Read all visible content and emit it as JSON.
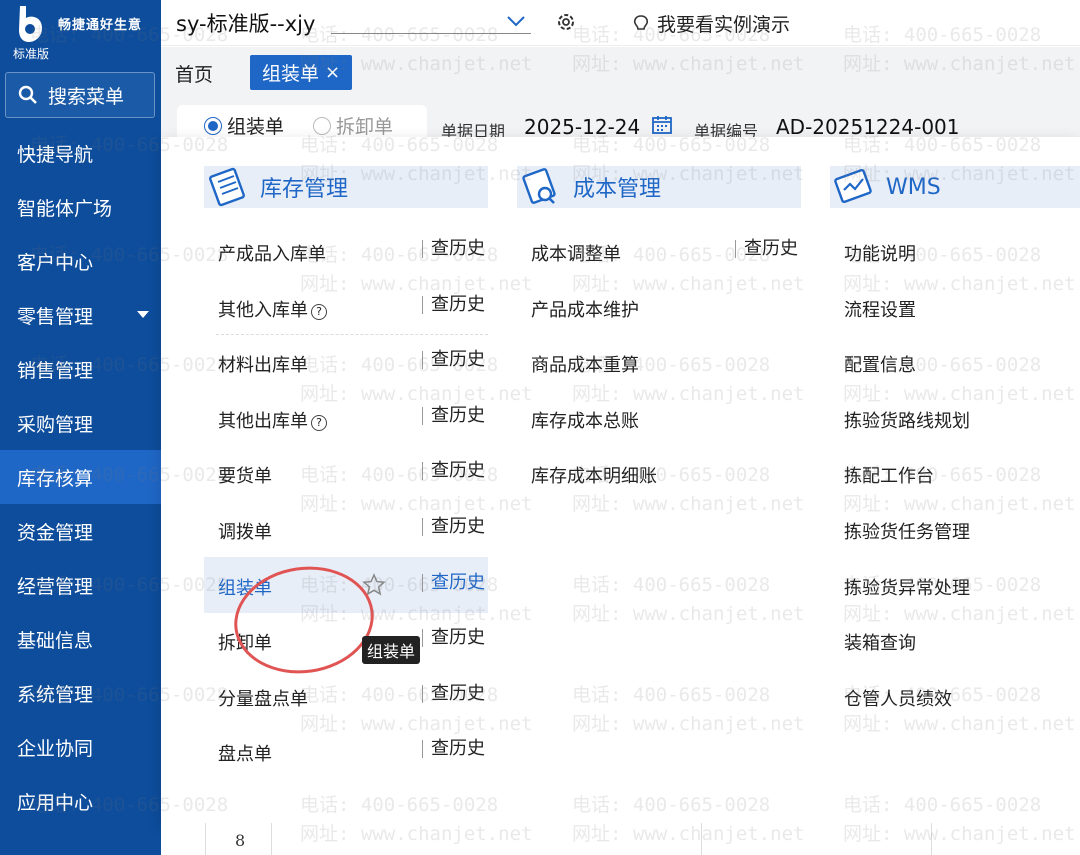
{
  "brand": {
    "name": "畅捷通好生意",
    "edition": "标准版"
  },
  "sidebar": {
    "search_label": "搜索菜单",
    "items": [
      {
        "label": "快捷导航"
      },
      {
        "label": "智能体广场"
      },
      {
        "label": "客户中心"
      },
      {
        "label": "零售管理"
      },
      {
        "label": "销售管理"
      },
      {
        "label": "采购管理"
      },
      {
        "label": "库存核算"
      },
      {
        "label": "资金管理"
      },
      {
        "label": "经营管理"
      },
      {
        "label": "基础信息"
      },
      {
        "label": "系统管理"
      },
      {
        "label": "企业协同"
      },
      {
        "label": "应用中心"
      }
    ],
    "active_index": 6
  },
  "topbar": {
    "account": "sy-标准版--xjy",
    "demo_label": "我要看实例演示"
  },
  "tabs": {
    "home": "首页",
    "active": "组装单",
    "close": "×"
  },
  "form": {
    "radio_assemble": "组装单",
    "radio_disassemble": "拆卸单",
    "date_label": "单据日期",
    "date_value": "2025-12-24",
    "number_label": "单据编号",
    "number_value": "AD-20251224-001"
  },
  "menu": {
    "history_label": "查历史",
    "columns": [
      {
        "title": "库存管理",
        "items": [
          {
            "label": "产成品入库单",
            "help": false,
            "history": true
          },
          {
            "label": "其他入库单",
            "help": true,
            "history": true
          },
          {
            "label": "材料出库单",
            "help": false,
            "history": true
          },
          {
            "label": "其他出库单",
            "help": true,
            "history": true
          },
          {
            "label": "要货单",
            "help": false,
            "history": true
          },
          {
            "label": "调拨单",
            "help": false,
            "history": true
          },
          {
            "label": "组装单",
            "help": false,
            "history": true
          },
          {
            "label": "拆卸单",
            "help": false,
            "history": true
          },
          {
            "label": "分量盘点单",
            "help": false,
            "history": true
          },
          {
            "label": "盘点单",
            "help": false,
            "history": true
          }
        ]
      },
      {
        "title": "成本管理",
        "items": [
          {
            "label": "成本调整单",
            "history": true
          },
          {
            "label": "产品成本维护",
            "history": false
          },
          {
            "label": "商品成本重算",
            "history": false
          },
          {
            "label": "库存成本总账",
            "history": false
          },
          {
            "label": "库存成本明细账",
            "history": false
          }
        ]
      },
      {
        "title": "WMS",
        "items": [
          {
            "label": "功能说明"
          },
          {
            "label": "流程设置"
          },
          {
            "label": "配置信息"
          },
          {
            "label": "拣验货路线规划"
          },
          {
            "label": "拣配工作台"
          },
          {
            "label": "拣验货任务管理"
          },
          {
            "label": "拣验货异常处理"
          },
          {
            "label": "装箱查询"
          },
          {
            "label": "仓管人员绩效"
          }
        ]
      }
    ],
    "tooltip": "组装单",
    "highlighted": "组装单"
  },
  "watermark": {
    "phone": "电话: 400-665-0028",
    "site": "网址: www.chanjet.net"
  },
  "table_peek": {
    "row_number": "8"
  },
  "colors": {
    "sidebar": "#0d4d9c",
    "accent": "#1f67c6",
    "annotation": "#e05454"
  }
}
